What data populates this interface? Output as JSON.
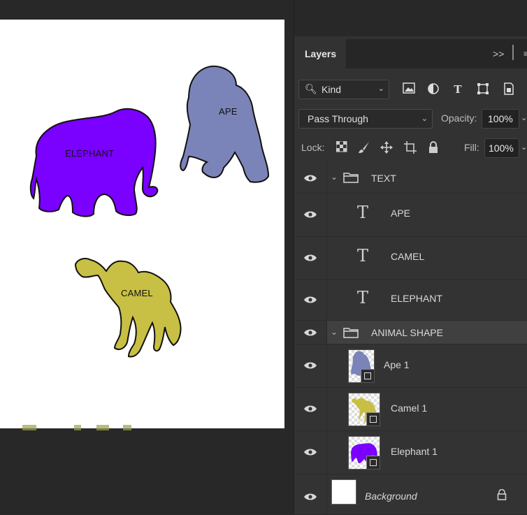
{
  "canvas": {
    "shapes": [
      {
        "label": "ELEPHANT",
        "color": "#7a00ff"
      },
      {
        "label": "APE",
        "color": "#7b84b8"
      },
      {
        "label": "CAMEL",
        "color": "#c8c044"
      }
    ]
  },
  "panel": {
    "tab_label": "Layers",
    "expand_label": ">>",
    "filter": {
      "kind_label": "Kind"
    },
    "blend_mode": "Pass Through",
    "opacity_label": "Opacity:",
    "opacity_value": "100%",
    "lock_label": "Lock:",
    "fill_label": "Fill:",
    "fill_value": "100%"
  },
  "layers": [
    {
      "name": "TEXT",
      "type": "group"
    },
    {
      "name": "APE",
      "type": "text"
    },
    {
      "name": "CAMEL",
      "type": "text"
    },
    {
      "name": "ELEPHANT",
      "type": "text"
    },
    {
      "name": "ANIMAL SHAPE",
      "type": "group",
      "selected": true
    },
    {
      "name": "Ape 1",
      "type": "shape",
      "color": "#7b84b8"
    },
    {
      "name": "Camel 1",
      "type": "shape",
      "color": "#c8c044"
    },
    {
      "name": "Elephant 1",
      "type": "shape",
      "color": "#7a00ff"
    },
    {
      "name": "Background",
      "type": "background",
      "locked": true
    }
  ]
}
